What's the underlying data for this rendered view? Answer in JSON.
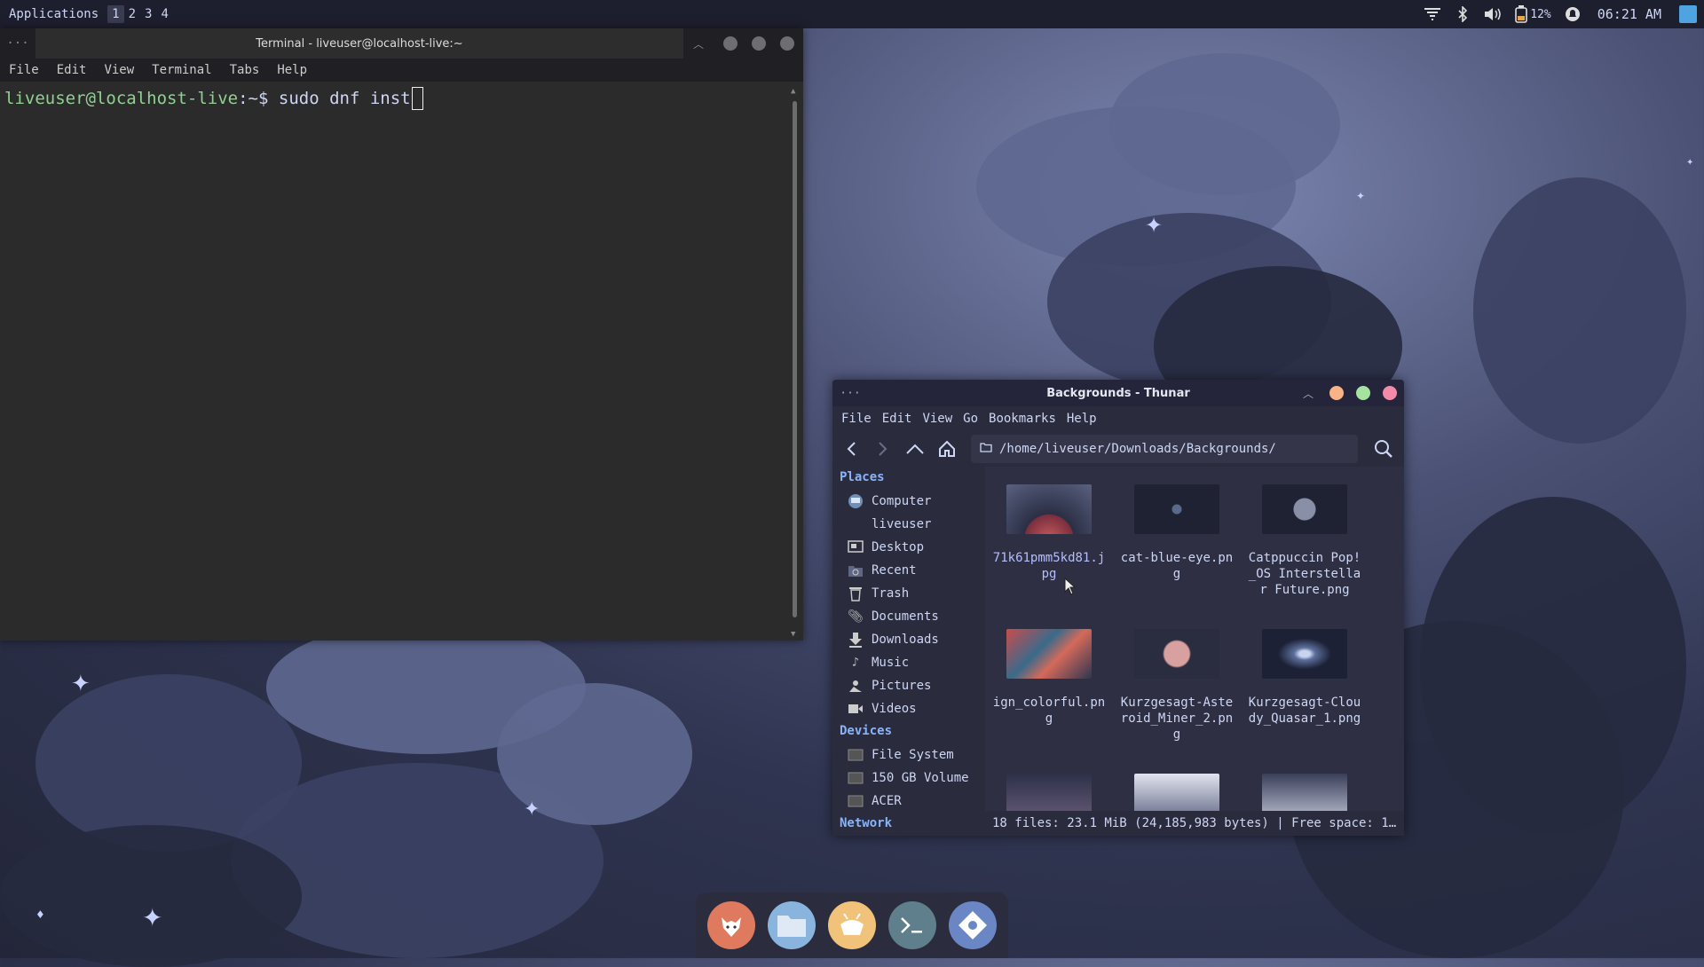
{
  "panel": {
    "applications_label": "Applications",
    "workspaces": [
      "1",
      "2",
      "3",
      "4"
    ],
    "active_workspace": "1",
    "battery_label": "12%",
    "clock": "06:21 AM"
  },
  "terminal": {
    "title": "Terminal - liveuser@localhost-live:~",
    "menu": [
      "File",
      "Edit",
      "View",
      "Terminal",
      "Tabs",
      "Help"
    ],
    "prompt_user": "liveuser@localhost-live",
    "prompt_rest": ":~$ ",
    "command": "sudo dnf inst"
  },
  "thunar": {
    "title": "Backgrounds - Thunar",
    "menu": [
      "File",
      "Edit",
      "View",
      "Go",
      "Bookmarks",
      "Help"
    ],
    "path": "/home/liveuser/Downloads/Backgrounds/",
    "places_label": "Places",
    "places": [
      "Computer",
      "liveuser",
      "Desktop",
      "Recent",
      "Trash",
      "Documents",
      "Downloads",
      "Music",
      "Pictures",
      "Videos"
    ],
    "devices_label": "Devices",
    "devices": [
      "File System",
      "150 GB Volume",
      "ACER"
    ],
    "network_label": "Network",
    "files": [
      "71k61pmm5kd81.jpg",
      "cat-blue-eye.png",
      "Catppuccin Pop!_OS Interstellar Future.png",
      "ign_colorful.png",
      "Kurzgesagt-Asteroid_Miner_2.png",
      "Kurzgesagt-Cloudy_Quasar_1.png"
    ],
    "status": "18 files: 23.1 MiB (24,185,983 bytes)  |  Free space: 1…"
  },
  "dock": {
    "apps": [
      "firefox-icon",
      "files-icon",
      "gedit-icon",
      "terminal-icon",
      "software-icon"
    ]
  },
  "colors": {
    "panel_bg": "#1e1f2e",
    "accent_blue": "#89b4fa",
    "close_red": "#f38ba8",
    "max_green": "#a6e3a1",
    "min_orange": "#fab387"
  }
}
